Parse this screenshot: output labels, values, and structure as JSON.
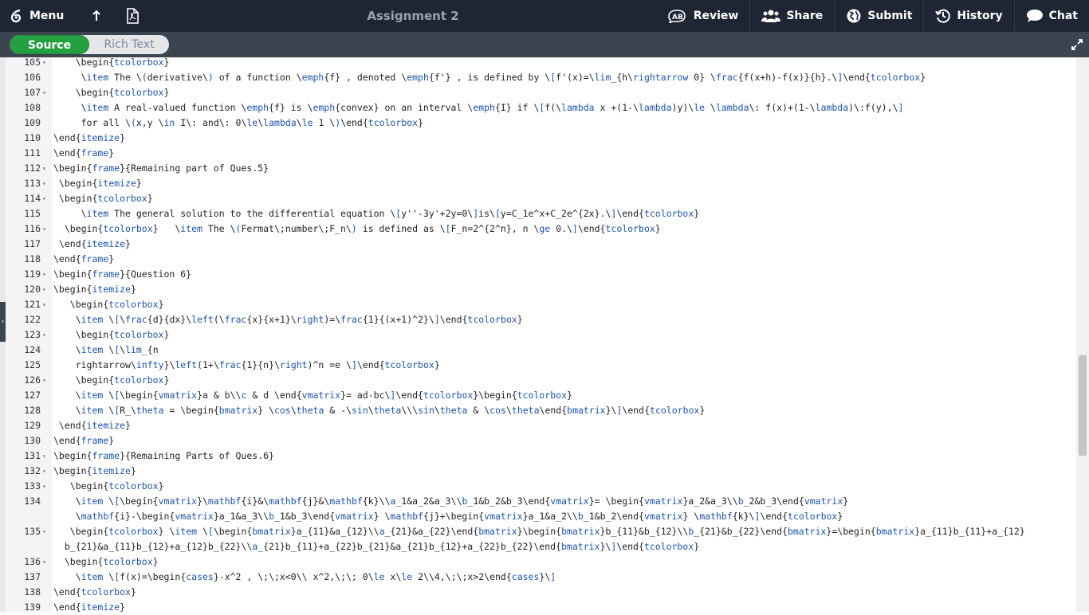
{
  "toolbar": {
    "menu_label": "Menu",
    "title": "Assignment 2",
    "review_label": "Review",
    "share_label": "Share",
    "submit_label": "Submit",
    "history_label": "History",
    "chat_label": "Chat"
  },
  "view_toggle": {
    "source_label": "Source",
    "rich_label": "Rich Text",
    "active": "Source"
  },
  "editor": {
    "lines": [
      {
        "n": "105",
        "fold": true,
        "text": "    \\begin{tcolorbox}"
      },
      {
        "n": "106",
        "fold": false,
        "text": "     \\item The \\(derivative\\) of a function \\emph{f} , denoted \\emph{f'} , is defined by \\[f'(x)=\\lim_{h\\rightarrow 0} \\frac{f(x+h)-f(x)}{h}.\\]\\end{tcolorbox}"
      },
      {
        "n": "107",
        "fold": true,
        "text": "    \\begin{tcolorbox}"
      },
      {
        "n": "108",
        "fold": false,
        "text": "     \\item A real-valued function \\emph{f} is \\emph{convex} on an interval \\emph{I} if \\[f(\\lambda x +(1-\\lambda)y)\\le \\lambda\\: f(x)+(1-\\lambda)\\:f(y),\\]"
      },
      {
        "n": "109",
        "fold": false,
        "text": "     for all \\(x,y \\in I\\: and\\: 0\\le\\lambda\\le 1 \\)\\end{tcolorbox}"
      },
      {
        "n": "110",
        "fold": false,
        "text": "\\end{itemize}"
      },
      {
        "n": "111",
        "fold": false,
        "text": "\\end{frame}"
      },
      {
        "n": "112",
        "fold": true,
        "text": "\\begin{frame}{Remaining part of Ques.5}"
      },
      {
        "n": "113",
        "fold": true,
        "text": " \\begin{itemize}"
      },
      {
        "n": "114",
        "fold": true,
        "text": " \\begin{tcolorbox}"
      },
      {
        "n": "115",
        "fold": false,
        "text": "     \\item The general solution to the differential equation \\[y''-3y'+2y=0\\]is\\[y=C_1e^x+C_2e^{2x}.\\]\\end{tcolorbox}"
      },
      {
        "n": "116",
        "fold": true,
        "text": "  \\begin{tcolorbox}   \\item The \\(Fermat\\;number\\;F_n\\) is defined as \\[F_n=2^{2^n}, n \\ge 0.\\]\\end{tcolorbox}"
      },
      {
        "n": "117",
        "fold": false,
        "text": " \\end{itemize}"
      },
      {
        "n": "118",
        "fold": false,
        "text": "\\end{frame}"
      },
      {
        "n": "119",
        "fold": true,
        "text": "\\begin{frame}{Question 6}"
      },
      {
        "n": "120",
        "fold": true,
        "text": "\\begin{itemize}"
      },
      {
        "n": "121",
        "fold": true,
        "text": "   \\begin{tcolorbox}"
      },
      {
        "n": "122",
        "fold": false,
        "text": "    \\item \\[\\frac{d}{dx}\\left(\\frac{x}{x+1}\\right)=\\frac{1}{(x+1)^2}\\]\\end{tcolorbox}"
      },
      {
        "n": "123",
        "fold": true,
        "text": "    \\begin{tcolorbox}"
      },
      {
        "n": "124",
        "fold": false,
        "text": "    \\item \\[\\lim_{n"
      },
      {
        "n": "125",
        "fold": false,
        "text": "    rightarrow\\infty}\\left(1+\\frac{1}{n}\\right)^n =e \\]\\end{tcolorbox}"
      },
      {
        "n": "126",
        "fold": true,
        "text": "    \\begin{tcolorbox}"
      },
      {
        "n": "127",
        "fold": false,
        "text": "    \\item \\[\\begin{vmatrix}a & b\\\\c & d \\end{vmatrix}= ad-bc\\]\\end{tcolorbox}\\begin{tcolorbox}"
      },
      {
        "n": "128",
        "fold": false,
        "text": "    \\item \\[R_\\theta = \\begin{bmatrix} \\cos\\theta & -\\sin\\theta\\\\\\sin\\theta & \\cos\\theta\\end{bmatrix}\\]\\end{tcolorbox}"
      },
      {
        "n": "129",
        "fold": false,
        "text": " \\end{itemize}"
      },
      {
        "n": "130",
        "fold": false,
        "text": "\\end{frame}"
      },
      {
        "n": "131",
        "fold": true,
        "text": "\\begin{frame}{Remaining Parts of Ques.6}"
      },
      {
        "n": "132",
        "fold": true,
        "text": "\\begin{itemize}"
      },
      {
        "n": "133",
        "fold": true,
        "text": "   \\begin{tcolorbox}"
      },
      {
        "n": "134",
        "fold": false,
        "text": "    \\item \\[\\begin{vmatrix}\\mathbf{i}&\\mathbf{j}&\\mathbf{k}\\\\a_1&a_2&a_3\\\\b_1&b_2&b_3\\end{vmatrix}= \\begin{vmatrix}a_2&a_3\\\\b_2&b_3\\end{vmatrix}"
      },
      {
        "n": "",
        "fold": false,
        "text": "    \\mathbf{i}-\\begin{vmatrix}a_1&a_3\\\\b_1&b_3\\end{vmatrix} \\mathbf{j}+\\begin{vmatrix}a_1&a_2\\\\b_1&b_2\\end{vmatrix} \\mathbf{k}\\]\\end{tcolorbox}"
      },
      {
        "n": "135",
        "fold": true,
        "text": "   \\begin{tcolorbox} \\item \\[\\begin{bmatrix}a_{11}&a_{12}\\\\a_{21}&a_{22}\\end{bmatrix}\\begin{bmatrix}b_{11}&b_{12}\\\\b_{21}&b_{22}\\end{bmatrix}=\\begin{bmatrix}a_{11}b_{11}+a_{12}"
      },
      {
        "n": "",
        "fold": false,
        "text": "  b_{21}&a_{11}b_{12}+a_{12}b_{22}\\\\a_{21}b_{11}+a_{22}b_{21}&a_{21}b_{12}+a_{22}b_{22}\\end{bmatrix}\\]\\end{tcolorbox}"
      },
      {
        "n": "136",
        "fold": true,
        "text": "  \\begin{tcolorbox}"
      },
      {
        "n": "137",
        "fold": false,
        "text": "    \\item \\[f(x)=\\begin{cases}-x^2 , \\;\\;x<0\\\\ x^2,\\;\\; 0\\le x\\le 2\\\\4,\\;\\;x>2\\end{cases}\\]"
      },
      {
        "n": "138",
        "fold": false,
        "text": "\\end{tcolorbox}"
      },
      {
        "n": "139",
        "fold": false,
        "text": "\\end{itemize}"
      }
    ]
  },
  "colors": {
    "topbar_bg": "#1e2633",
    "subbar_bg": "#3c4450",
    "source_active": "#24a041",
    "keyword": "#1b53a8"
  }
}
